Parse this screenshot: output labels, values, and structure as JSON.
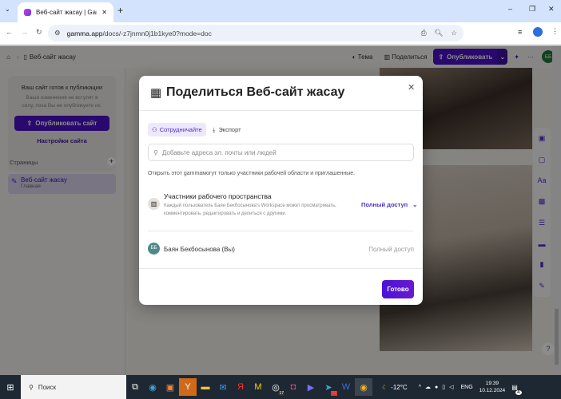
{
  "browser": {
    "tab_title": "Веб-сайт жасау | Gamma",
    "url_domain": "gamma.app",
    "url_path": "/docs/-z7jnmn0j1b1kye0?mode=doc"
  },
  "header": {
    "breadcrumb": "Веб-сайт жасау",
    "theme": "Тема",
    "share": "Поделиться",
    "publish": "Опубликовать",
    "avatar": "ББ"
  },
  "sidebar": {
    "card_title": "Ваш сайт готов к публикации",
    "card_text": "Ваши изменения не вступят в силу, пока Вы не опубликуете их.",
    "publish_site": "Опубликовать сайт",
    "site_settings": "Настройки сайта",
    "pages_label": "Страницы",
    "pages": [
      {
        "title": "Веб-сайт жасау",
        "subtitle": "Главная"
      }
    ]
  },
  "modal": {
    "title": "Поделиться Веб-сайт жасау",
    "tabs": [
      {
        "label": "Сотрудничайте"
      },
      {
        "label": "Экспорт"
      }
    ],
    "search_placeholder": "Добавьте адреса эл. почты или людей",
    "access_note": "Открыть этот gammaмогут только участники рабочей области и приглашенные.",
    "workspace_title": "Участники рабочего пространства",
    "workspace_desc": "Каждый пользователь Баян Бекбосынова's Workspace может просматривать, комментировать, редактировать и делиться с другими.",
    "workspace_access": "Полный доступ",
    "user_initials": "ББ",
    "user_name": "Баян Бекбосынова (Вы)",
    "user_access": "Полный доступ",
    "done": "Готово"
  },
  "taskbar": {
    "search": "Поиск",
    "weather": "-12°C",
    "lang": "ENG",
    "time": "19:39",
    "date": "10.12.2024",
    "notif_count": "4",
    "badge_a": "17",
    "badge_b": "21"
  },
  "colors": {
    "accent": "#4b12c9",
    "avatar_green": "#1e7a34",
    "avatar_teal": "#4f8a88"
  }
}
